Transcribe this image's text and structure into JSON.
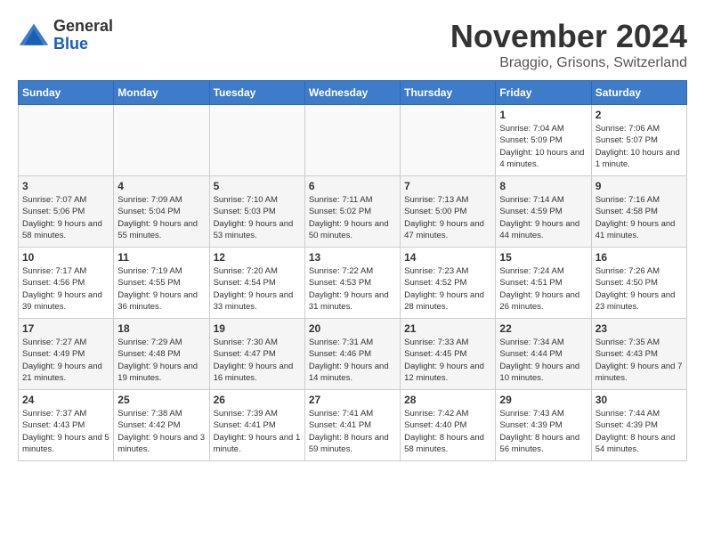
{
  "header": {
    "logo_line1": "General",
    "logo_line2": "Blue",
    "month": "November 2024",
    "location": "Braggio, Grisons, Switzerland"
  },
  "days_of_week": [
    "Sunday",
    "Monday",
    "Tuesday",
    "Wednesday",
    "Thursday",
    "Friday",
    "Saturday"
  ],
  "weeks": [
    [
      {
        "day": "",
        "info": ""
      },
      {
        "day": "",
        "info": ""
      },
      {
        "day": "",
        "info": ""
      },
      {
        "day": "",
        "info": ""
      },
      {
        "day": "",
        "info": ""
      },
      {
        "day": "1",
        "info": "Sunrise: 7:04 AM\nSunset: 5:09 PM\nDaylight: 10 hours and 4 minutes."
      },
      {
        "day": "2",
        "info": "Sunrise: 7:06 AM\nSunset: 5:07 PM\nDaylight: 10 hours and 1 minute."
      }
    ],
    [
      {
        "day": "3",
        "info": "Sunrise: 7:07 AM\nSunset: 5:06 PM\nDaylight: 9 hours and 58 minutes."
      },
      {
        "day": "4",
        "info": "Sunrise: 7:09 AM\nSunset: 5:04 PM\nDaylight: 9 hours and 55 minutes."
      },
      {
        "day": "5",
        "info": "Sunrise: 7:10 AM\nSunset: 5:03 PM\nDaylight: 9 hours and 53 minutes."
      },
      {
        "day": "6",
        "info": "Sunrise: 7:11 AM\nSunset: 5:02 PM\nDaylight: 9 hours and 50 minutes."
      },
      {
        "day": "7",
        "info": "Sunrise: 7:13 AM\nSunset: 5:00 PM\nDaylight: 9 hours and 47 minutes."
      },
      {
        "day": "8",
        "info": "Sunrise: 7:14 AM\nSunset: 4:59 PM\nDaylight: 9 hours and 44 minutes."
      },
      {
        "day": "9",
        "info": "Sunrise: 7:16 AM\nSunset: 4:58 PM\nDaylight: 9 hours and 41 minutes."
      }
    ],
    [
      {
        "day": "10",
        "info": "Sunrise: 7:17 AM\nSunset: 4:56 PM\nDaylight: 9 hours and 39 minutes."
      },
      {
        "day": "11",
        "info": "Sunrise: 7:19 AM\nSunset: 4:55 PM\nDaylight: 9 hours and 36 minutes."
      },
      {
        "day": "12",
        "info": "Sunrise: 7:20 AM\nSunset: 4:54 PM\nDaylight: 9 hours and 33 minutes."
      },
      {
        "day": "13",
        "info": "Sunrise: 7:22 AM\nSunset: 4:53 PM\nDaylight: 9 hours and 31 minutes."
      },
      {
        "day": "14",
        "info": "Sunrise: 7:23 AM\nSunset: 4:52 PM\nDaylight: 9 hours and 28 minutes."
      },
      {
        "day": "15",
        "info": "Sunrise: 7:24 AM\nSunset: 4:51 PM\nDaylight: 9 hours and 26 minutes."
      },
      {
        "day": "16",
        "info": "Sunrise: 7:26 AM\nSunset: 4:50 PM\nDaylight: 9 hours and 23 minutes."
      }
    ],
    [
      {
        "day": "17",
        "info": "Sunrise: 7:27 AM\nSunset: 4:49 PM\nDaylight: 9 hours and 21 minutes."
      },
      {
        "day": "18",
        "info": "Sunrise: 7:29 AM\nSunset: 4:48 PM\nDaylight: 9 hours and 19 minutes."
      },
      {
        "day": "19",
        "info": "Sunrise: 7:30 AM\nSunset: 4:47 PM\nDaylight: 9 hours and 16 minutes."
      },
      {
        "day": "20",
        "info": "Sunrise: 7:31 AM\nSunset: 4:46 PM\nDaylight: 9 hours and 14 minutes."
      },
      {
        "day": "21",
        "info": "Sunrise: 7:33 AM\nSunset: 4:45 PM\nDaylight: 9 hours and 12 minutes."
      },
      {
        "day": "22",
        "info": "Sunrise: 7:34 AM\nSunset: 4:44 PM\nDaylight: 9 hours and 10 minutes."
      },
      {
        "day": "23",
        "info": "Sunrise: 7:35 AM\nSunset: 4:43 PM\nDaylight: 9 hours and 7 minutes."
      }
    ],
    [
      {
        "day": "24",
        "info": "Sunrise: 7:37 AM\nSunset: 4:43 PM\nDaylight: 9 hours and 5 minutes."
      },
      {
        "day": "25",
        "info": "Sunrise: 7:38 AM\nSunset: 4:42 PM\nDaylight: 9 hours and 3 minutes."
      },
      {
        "day": "26",
        "info": "Sunrise: 7:39 AM\nSunset: 4:41 PM\nDaylight: 9 hours and 1 minute."
      },
      {
        "day": "27",
        "info": "Sunrise: 7:41 AM\nSunset: 4:41 PM\nDaylight: 8 hours and 59 minutes."
      },
      {
        "day": "28",
        "info": "Sunrise: 7:42 AM\nSunset: 4:40 PM\nDaylight: 8 hours and 58 minutes."
      },
      {
        "day": "29",
        "info": "Sunrise: 7:43 AM\nSunset: 4:39 PM\nDaylight: 8 hours and 56 minutes."
      },
      {
        "day": "30",
        "info": "Sunrise: 7:44 AM\nSunset: 4:39 PM\nDaylight: 8 hours and 54 minutes."
      }
    ]
  ]
}
